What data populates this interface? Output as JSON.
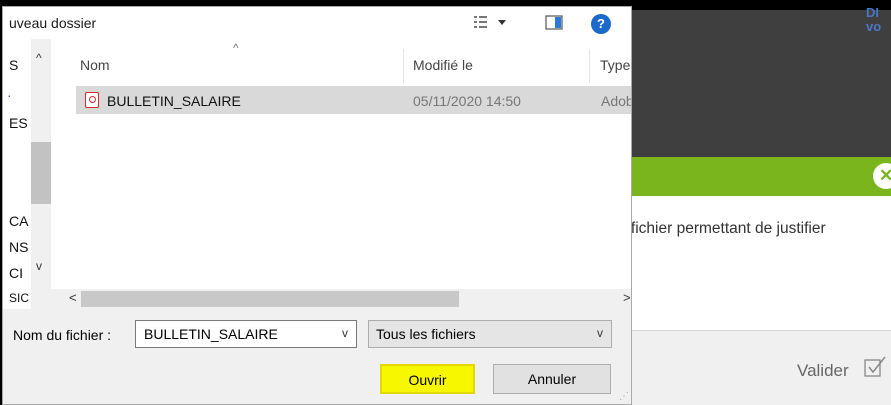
{
  "background_page": {
    "top_link_lines": [
      "DI",
      "vo"
    ],
    "close_glyph": "✕",
    "description": "e fichier permettant de justifier",
    "validate_label": "Valider",
    "colors": {
      "dark_band": "#3f3f3f",
      "green_band": "#7ab51d",
      "link": "#4a78c9"
    }
  },
  "dialog": {
    "title": "uveau dossier",
    "toolbar": {
      "view_menu_icon": "view-options-icon",
      "preview_pane_icon": "preview-pane-icon",
      "help_label": "?"
    },
    "nav_items": [
      "S",
      "ES",
      "CA",
      "NS",
      "CI",
      "SIC"
    ],
    "columns": {
      "name": "Nom",
      "modified": "Modifié le",
      "type": "Type"
    },
    "files": [
      {
        "name": "BULLETIN_SALAIRE",
        "modified": "05/11/2020 14:50",
        "type": "Adob",
        "icon": "pdf-icon",
        "selected": true
      }
    ],
    "filename_label": "Nom du fichier :",
    "filename_value": "BULLETIN_SALAIRE",
    "filter_value": "Tous les fichiers",
    "open_label": "Ouvrir",
    "cancel_label": "Annuler",
    "colors": {
      "open_highlight": "#f7f700",
      "help_badge": "#1b69c9",
      "selected_row": "#d9d9d9"
    }
  }
}
